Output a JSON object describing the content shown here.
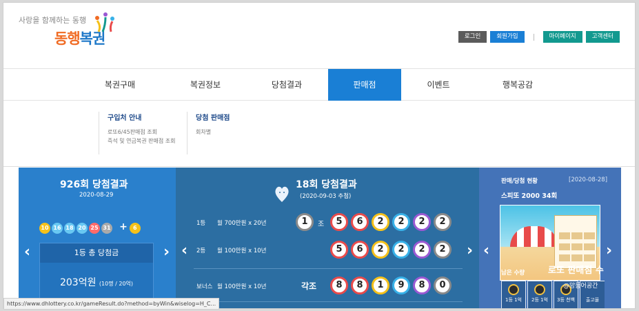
{
  "header": {
    "slogan": "사랑을 함께하는 동행",
    "logo_orange": "동행",
    "logo_blue": "복권",
    "buttons": {
      "login": "로그인",
      "join": "회원가입",
      "mypage": "마이페이지",
      "support": "고객센터"
    }
  },
  "nav": {
    "items": [
      "복권구매",
      "복권정보",
      "당첨결과",
      "판매점",
      "이벤트",
      "행복공감"
    ],
    "active": "판매점"
  },
  "submenu": {
    "col1": {
      "title": "구입처 안내",
      "links": [
        "로또6/45판매점 조회",
        "즉석 및 연금복권 판매점 조회"
      ]
    },
    "col2": {
      "title": "당첨 판매점",
      "links": [
        "회차별"
      ]
    }
  },
  "lotto": {
    "title": "926회 당첨결과",
    "date": "2020-08-29",
    "numbers": [
      "10",
      "16",
      "18",
      "20",
      "25",
      "31"
    ],
    "plus": "+",
    "bonus": "6",
    "prize_label": "1등 총 당첨금",
    "prize_amount": "203억원",
    "prize_detail": "(10명 / 20억)"
  },
  "pension": {
    "title": "18회 당첨결과",
    "date": "(2020-09-03 추첨)",
    "rows": [
      {
        "rank": "1등",
        "desc": "월 700만원 x 20년",
        "group": "1",
        "group_label": "조",
        "digits": [
          "5",
          "6",
          "2",
          "2",
          "2",
          "2"
        ]
      },
      {
        "rank": "2등",
        "desc": "월 100만원 x 10년",
        "digits": [
          "5",
          "6",
          "2",
          "2",
          "2",
          "2"
        ]
      },
      {
        "rank": "보너스",
        "desc": "월 100만원 x 10년",
        "group_label": "각조",
        "digits": [
          "8",
          "8",
          "1",
          "9",
          "8",
          "0"
        ]
      }
    ]
  },
  "shop": {
    "title": "판매/당첨 현황",
    "date": "[2020-08-28]",
    "product": "스피또 2000 34회",
    "remain_label": "남은 수량",
    "ranks": [
      "1등 1억",
      "2등 1억",
      "3등 천백",
      "출고율"
    ],
    "overlay": "로또 판매점 수",
    "overlay_sub": "@망둥어공간"
  },
  "status_url": "https://www.dhlottery.co.kr/gameResult.do?method=byWin&wiselog=H_C..."
}
